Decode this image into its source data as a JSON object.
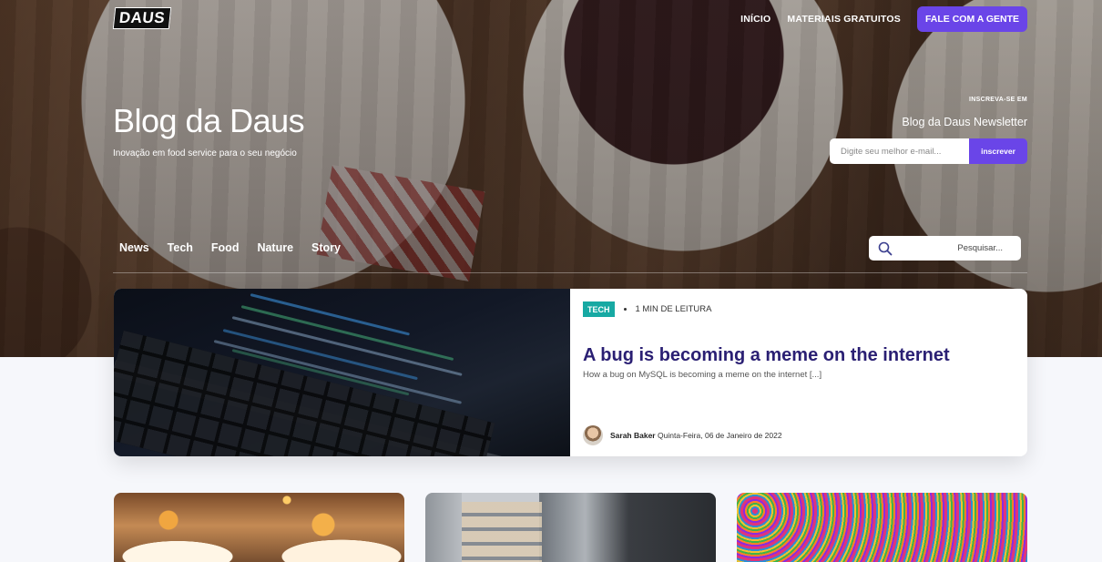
{
  "header": {
    "logo_text": "DAUS",
    "nav": [
      {
        "label": "INÍCIO"
      },
      {
        "label": "MATERIAIS GRATUITOS"
      }
    ],
    "cta_label": "FALE COM A GENTE"
  },
  "hero": {
    "title": "Blog da Daus",
    "subtitle": "Inovação em food service para o seu negócio"
  },
  "newsletter": {
    "kicker": "INSCREVA-SE EM",
    "title": "Blog da Daus Newsletter",
    "input_placeholder": "Digite seu melhor e-mail...",
    "button_label": "inscrever"
  },
  "categories": [
    "News",
    "Tech",
    "Food",
    "Nature",
    "Story"
  ],
  "search": {
    "placeholder": "Pesquisar..."
  },
  "featured_post": {
    "tag": "TECH",
    "read_time": "1 MIN DE LEITURA",
    "title": "A bug is becoming a meme on the internet",
    "excerpt": "How a bug on MySQL is becoming a meme on the internet [...]",
    "author": "Sarah Baker",
    "date": "Quinta-Feira, 06 de Janeiro de 2022"
  },
  "colors": {
    "accent": "#6a45e8",
    "tag": "#17a9a3",
    "title": "#2a1f73"
  }
}
